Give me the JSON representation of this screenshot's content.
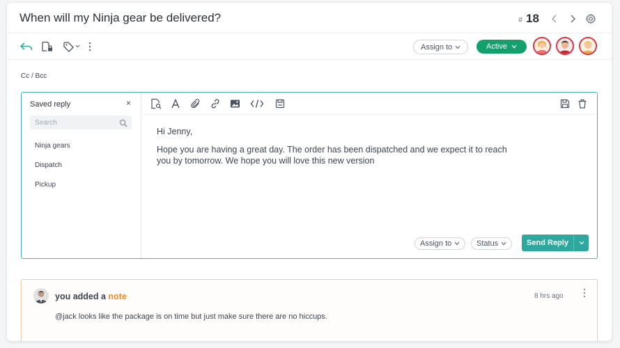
{
  "header": {
    "title": "When will my Ninja gear be delivered?",
    "ticket_hash": "#",
    "ticket_number": "18",
    "icons": [
      "chevron-left-icon",
      "chevron-right-icon",
      "gear-icon"
    ]
  },
  "toolbar": {
    "icons": [
      "reply-icon",
      "lock-note-icon",
      "tag-icon",
      "more-vertical-icon"
    ],
    "assign_label": "Assign to",
    "status_label": "Active",
    "status_color": "#13a06b",
    "avatar_border_color": "#d93240"
  },
  "cc_bcc": "Cc / Bcc",
  "saved_reply": {
    "title": "Saved reply",
    "close": "×",
    "search_placeholder": "Search",
    "items": [
      "Ninja gears",
      "Dispatch",
      "Pickup"
    ]
  },
  "editor": {
    "toolbar_icons": [
      "search-doc-icon",
      "text-format-icon",
      "attachment-icon",
      "link-icon",
      "image-icon",
      "code-icon",
      "template-icon",
      "save-icon",
      "trash-icon"
    ],
    "greeting": "Hi Jenny,",
    "body_line1": "Hope you are having a great day. The order has been dispatched and we expect it to reach",
    "body_line2": "you by tomorrow. We hope you will love this new version",
    "assign_label": "Assign to",
    "status_label": "Status",
    "send_label": "Send Reply",
    "accent_color": "#3fb5b0"
  },
  "note": {
    "prefix": "you added a ",
    "highlight": "note",
    "highlight_color": "#f08a24",
    "time": "8 hrs ago",
    "body": "@jack looks like the package is on time but just make sure there are no hiccups."
  }
}
